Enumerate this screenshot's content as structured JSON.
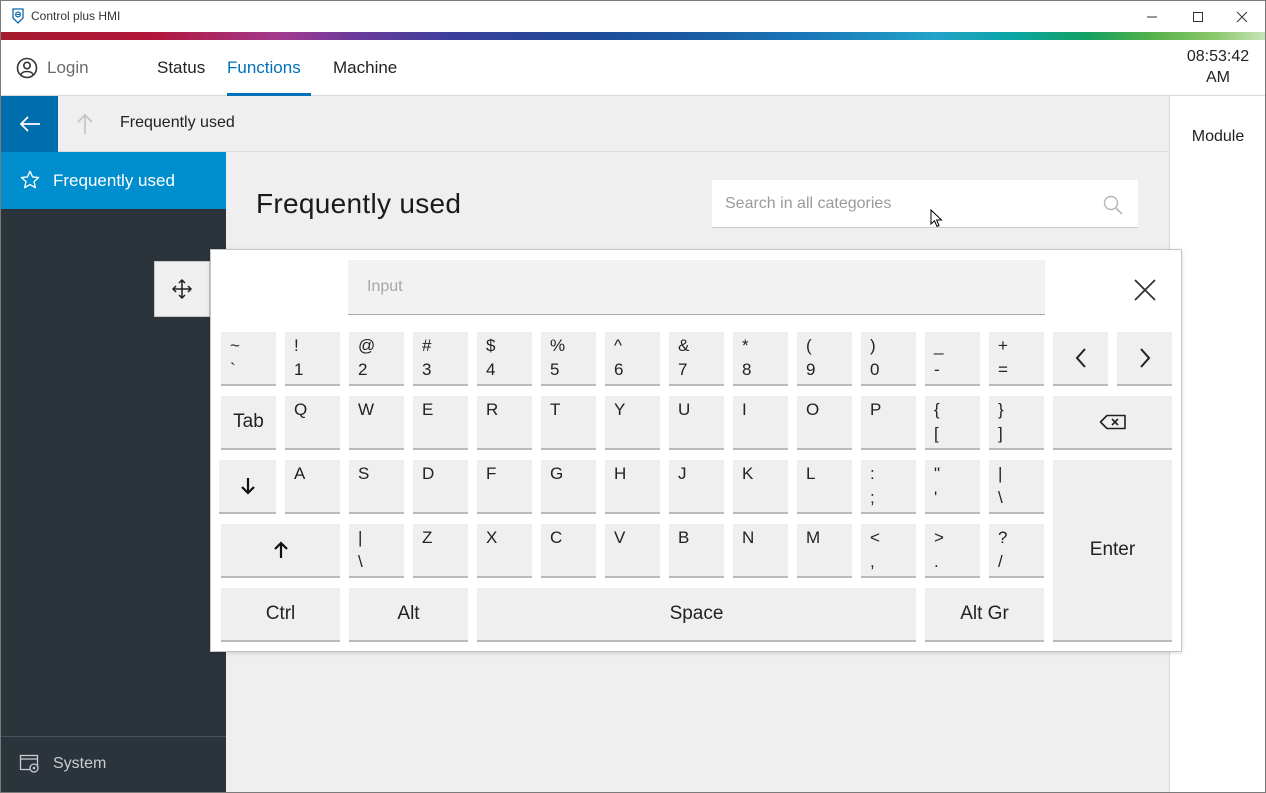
{
  "window": {
    "title": "Control plus HMI"
  },
  "nav": {
    "login": "Login",
    "tabs": [
      "Status",
      "Functions",
      "Machine"
    ],
    "clock_time": "08:53:42",
    "clock_ampm": "AM"
  },
  "breadcrumb": {
    "label": "Frequently used"
  },
  "right_panel": {
    "label": "Module"
  },
  "sidebar": {
    "active_item": "Frequently used",
    "system": "System"
  },
  "main": {
    "title": "Frequently used",
    "search_placeholder": "Search in all categories"
  },
  "keyboard": {
    "input_placeholder": "Input",
    "row1": [
      {
        "top": "~",
        "bot": "`"
      },
      {
        "top": "!",
        "bot": "1"
      },
      {
        "top": "@",
        "bot": "2"
      },
      {
        "top": "#",
        "bot": "3"
      },
      {
        "top": "$",
        "bot": "4"
      },
      {
        "top": "%",
        "bot": "5"
      },
      {
        "top": "^",
        "bot": "6"
      },
      {
        "top": "&",
        "bot": "7"
      },
      {
        "top": "*",
        "bot": "8"
      },
      {
        "top": "(",
        "bot": "9"
      },
      {
        "top": ")",
        "bot": "0"
      },
      {
        "top": "_",
        "bot": "-"
      },
      {
        "top": "+",
        "bot": "="
      }
    ],
    "row2_letters": [
      "Q",
      "W",
      "E",
      "R",
      "T",
      "Y",
      "U",
      "I",
      "O",
      "P"
    ],
    "row2_extra": [
      {
        "top": "{",
        "bot": "["
      },
      {
        "top": "}",
        "bot": "]"
      }
    ],
    "row3_letters": [
      "A",
      "S",
      "D",
      "F",
      "G",
      "H",
      "J",
      "K",
      "L"
    ],
    "row3_extra": [
      {
        "top": ":",
        "bot": ";"
      },
      {
        "top": "\"",
        "bot": "'"
      },
      {
        "top": "|",
        "bot": "\\"
      }
    ],
    "row4_first": {
      "top": "|",
      "bot": "\\"
    },
    "row4_letters": [
      "Z",
      "X",
      "C",
      "V",
      "B",
      "N",
      "M"
    ],
    "row4_extra": [
      {
        "top": "<",
        "bot": ","
      },
      {
        "top": ">",
        "bot": "."
      },
      {
        "top": "?",
        "bot": "/"
      }
    ],
    "tab": "Tab",
    "enter": "Enter",
    "ctrl": "Ctrl",
    "alt": "Alt",
    "space": "Space",
    "altgr": "Alt Gr"
  },
  "colors": {
    "accent": "#0071b9",
    "sidebar_bg": "#2b333b",
    "sidebar_active": "#008ecf",
    "back_button": "#006ead"
  }
}
